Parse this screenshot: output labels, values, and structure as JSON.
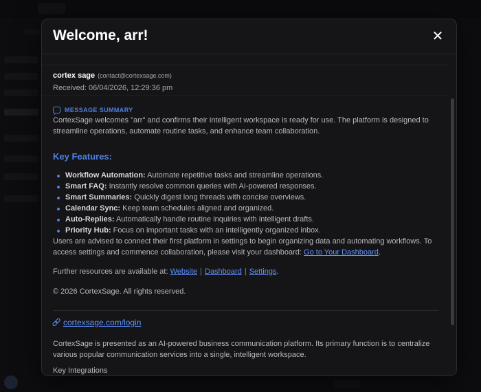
{
  "modal": {
    "title": "Welcome, arr!",
    "close_glyph": "✕"
  },
  "sender": {
    "name": "cortex sage",
    "email": "(contact@cortexsage.com)",
    "received": "Received: 06/04/2026, 12:29:36 pm"
  },
  "summary": {
    "label": "MESSAGE SUMMARY",
    "icon": "chat-bubble-icon",
    "text": "CortexSage welcomes \"arr\" and confirms their intelligent workspace is ready for use. The platform is designed to streamline operations, automate routine tasks, and enhance team collaboration."
  },
  "features": {
    "heading": "Key Features:",
    "items": [
      {
        "name": "Workflow Automation:",
        "desc": " Automate repetitive tasks and streamline operations."
      },
      {
        "name": "Smart FAQ:",
        "desc": " Instantly resolve common queries with AI-powered responses."
      },
      {
        "name": "Smart Summaries:",
        "desc": " Quickly digest long threads with concise overviews."
      },
      {
        "name": "Calendar Sync:",
        "desc": " Keep team schedules aligned and organized."
      },
      {
        "name": "Auto-Replies:",
        "desc": " Automatically handle routine inquiries with intelligent drafts."
      },
      {
        "name": "Priority Hub:",
        "desc": " Focus on important tasks with an intelligently organized inbox."
      }
    ]
  },
  "advice": {
    "text": "Users are advised to connect their first platform in settings to begin organizing data and automating workflows. To access settings and commence collaboration, please visit your dashboard: ",
    "link": "Go to Your Dashboard",
    "end": "."
  },
  "resources": {
    "prefix": "Further resources are available at: ",
    "links": [
      "Website",
      "Dashboard",
      "Settings"
    ],
    "separator": "|",
    "end": "."
  },
  "copyright": "© 2026 CortexSage. All rights reserved.",
  "login": {
    "icon": "link-icon",
    "text": "cortexsage.com/login"
  },
  "about": "CortexSage is presented as an AI-powered business communication platform. Its primary function is to centralize various popular communication services into a single, intelligent workspace.",
  "integrations_heading": "Key Integrations",
  "colors": {
    "accent": "#4f7fe0",
    "link": "#5f92ff",
    "modal_bg": "#151517"
  }
}
